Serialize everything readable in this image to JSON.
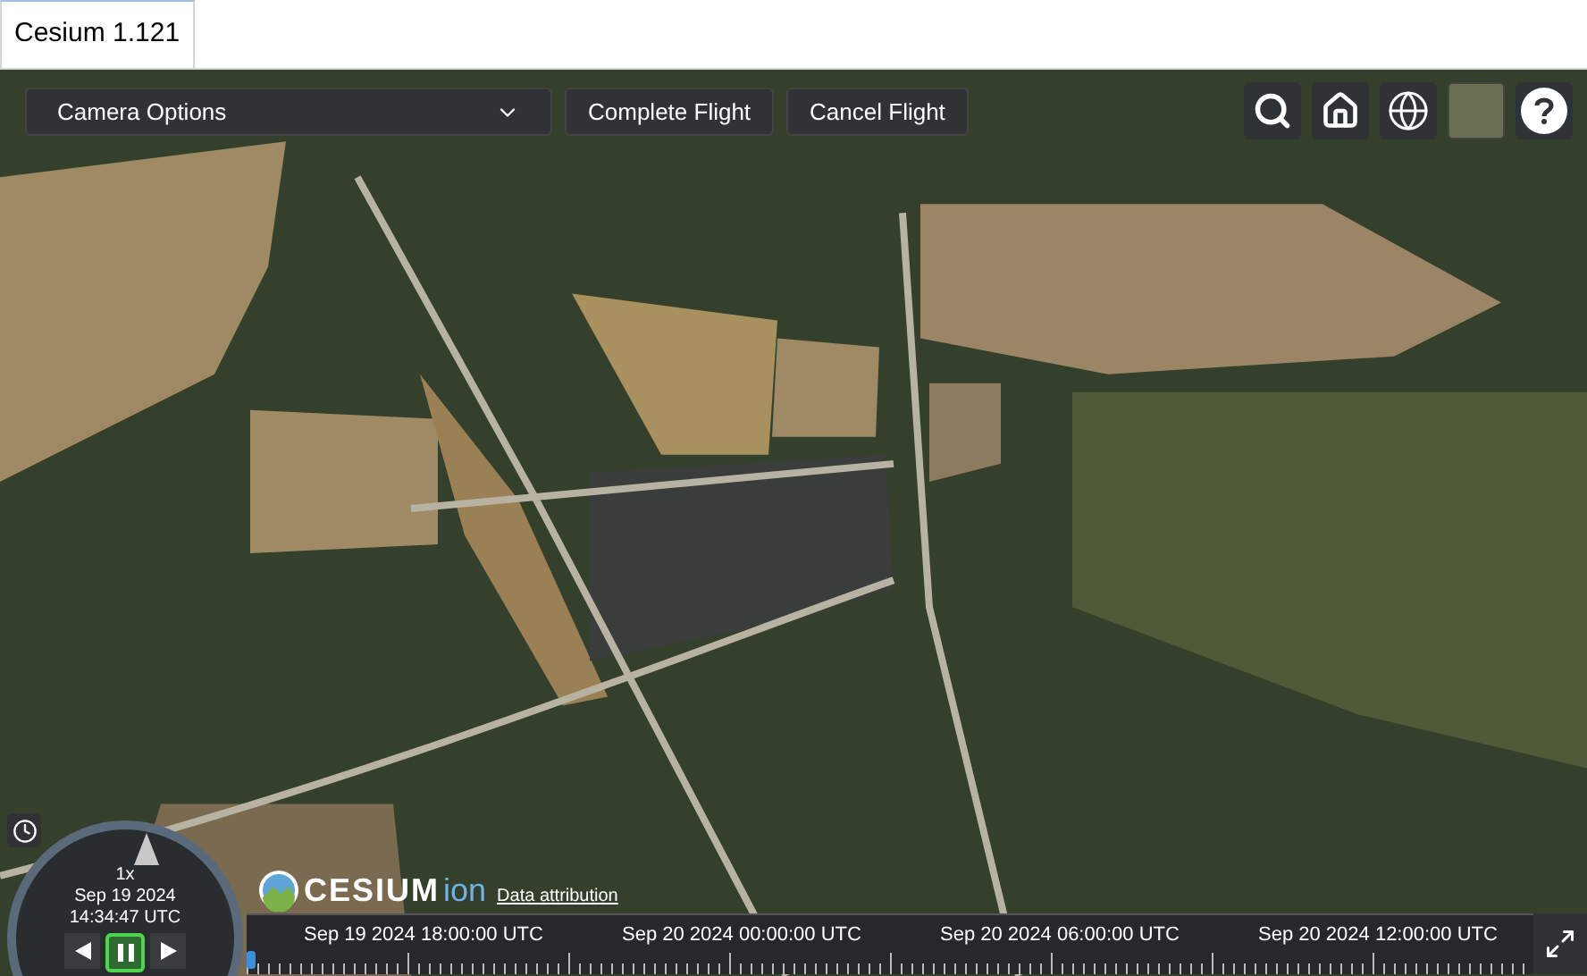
{
  "tab": {
    "label": "Cesium 1.121",
    "selected": true
  },
  "toolbar": {
    "camera_select": {
      "value": "Camera Options"
    },
    "buttons": [
      "Complete Flight",
      "Cancel Flight"
    ]
  },
  "animation": {
    "speed": "1x",
    "date": "Sep 19 2024",
    "time": "14:34:47 UTC",
    "playing": true
  },
  "credits": {
    "logo_text": "CESIUM",
    "logo_suffix": "ion",
    "link": "Data attribution"
  },
  "timeline": {
    "labels": [
      "Sep 19 2024 18:00:00 UTC",
      "Sep 20 2024 00:00:00 UTC",
      "Sep 20 2024 06:00:00 UTC",
      "Sep 20 2024 12:00:00 UTC"
    ]
  }
}
